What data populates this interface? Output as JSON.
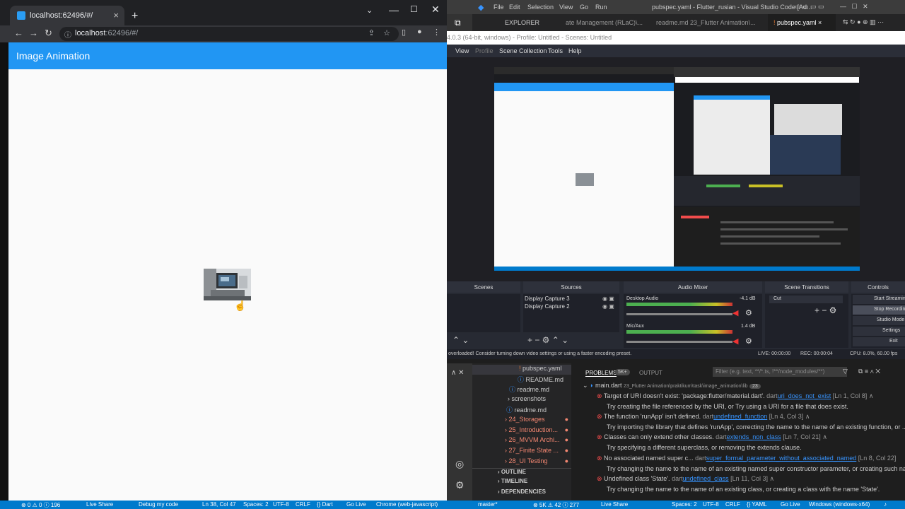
{
  "browser": {
    "tab_title": "localhost:62496/#/",
    "new_tab": "+",
    "url_host": "localhost",
    "url_rest": ":62496/#/"
  },
  "app": {
    "title": "Image Animation"
  },
  "vscode": {
    "menu": [
      "File",
      "Edit",
      "Selection",
      "View",
      "Go",
      "Run"
    ],
    "window_title": "pubspec.yaml - Flutter_rusian - Visual Studio Code [Ad...",
    "sidebar_title": "EXPLORER",
    "tabs": [
      "ate Management (RLaC)\\...",
      "readme.md  23_Flutter Animation\\...",
      "pubspec.yaml"
    ],
    "explorer_items": [
      {
        "label": "pubspec.yaml",
        "icon": "!",
        "color": "#cccccc"
      },
      {
        "label": "README.md",
        "icon": "ⓘ",
        "color": "#cccccc"
      },
      {
        "label": "readme.md",
        "icon": "ⓘ",
        "color": "#cccccc"
      },
      {
        "label": "screenshots",
        "icon": ">",
        "color": "#cccccc"
      },
      {
        "label": "readme.md",
        "icon": "ⓘ",
        "color": "#cccccc"
      },
      {
        "label": "24_Storages",
        "icon": ">",
        "color": "#f48771"
      },
      {
        "label": "25_Introduction...",
        "icon": ">",
        "color": "#f48771"
      },
      {
        "label": "26_MVVM Archi...",
        "icon": ">",
        "color": "#f48771"
      },
      {
        "label": "27_Finite State ...",
        "icon": ">",
        "color": "#f48771"
      },
      {
        "label": "28_UI Testing",
        "icon": ">",
        "color": "#f48771"
      }
    ],
    "outline": [
      "OUTLINE",
      "TIMELINE",
      "DEPENDENCIES"
    ],
    "panel_tabs": {
      "problems": "PROBLEMS",
      "count": "5K+",
      "output": "OUTPUT"
    },
    "filter_placeholder": "Filter (e.g. text, **/*.ts, !**/node_modules/**)",
    "file_header": {
      "name": "main.dart",
      "path": "23_Flutter Animation\\praktikum\\task\\image_animation\\lib",
      "count": "23"
    },
    "problems": [
      {
        "msg": "Target of URI doesn't exist: 'package:flutter/material.dart'.",
        "src": "dart",
        "code": "uri_does_not_exist",
        "loc": "[Ln 1, Col 8]",
        "hint": "Try creating the file referenced by the URI, or Try using a URI for a file that does exist."
      },
      {
        "msg": "The function 'runApp' isn't defined.",
        "src": "dart",
        "code": "undefined_function",
        "loc": "[Ln 4, Col 3]",
        "hint": "Try importing the library that defines 'runApp', correcting the name to the name of an existing function, or ..."
      },
      {
        "msg": "Classes can only extend other classes.",
        "src": "dart",
        "code": "extends_non_class",
        "loc": "[Ln 7, Col 21]",
        "hint": "Try specifying a different superclass, or removing the extends clause."
      },
      {
        "msg": "No associated named super c...",
        "src": "dart",
        "code": "super_formal_parameter_without_associated_named",
        "loc": "[Ln 8, Col 22]",
        "hint": "Try changing the name to the name of an existing named super constructor parameter, or creating such na..."
      },
      {
        "msg": "Undefined class 'State'.",
        "src": "dart",
        "code": "undefined_class",
        "loc": "[Ln 11, Col 3]",
        "hint": "Try changing the name to the name of an existing class, or creating a class with the name 'State'."
      }
    ]
  },
  "obs": {
    "title": "4.0.3 (64-bit, windows) - Profile: Untitled - Scenes: Untitled",
    "menu": [
      "View",
      "Profile",
      "Scene Collection",
      "Tools",
      "Help"
    ],
    "docks": {
      "scenes": "Scenes",
      "sources": "Sources",
      "mixer": "Audio Mixer",
      "transitions": "Scene Transitions",
      "controls": "Controls"
    },
    "sources": [
      "Display Capture 3",
      "Display Capture 2"
    ],
    "mixer": [
      {
        "name": "Desktop Audio",
        "db": "-4.1 dB"
      },
      {
        "name": "Mic/Aux",
        "db": "1.4 dB"
      }
    ],
    "transition": "Cut",
    "controls": [
      "Start Streaming",
      "Stop Recording",
      "Studio Mode",
      "Settings",
      "Exit"
    ],
    "status_msg": "overloaded! Consider turning down video settings or using a faster encoding preset.",
    "live": "LIVE: 00:00:00",
    "rec": "REC: 00:00:04",
    "cpu": "CPU: 8.0%, 60.00 fps"
  },
  "statusbar_left": [
    "⊗ 0 ⚠ 0 ⓘ 196",
    "Live Share",
    "Debug my code",
    "Ln 38, Col 47",
    "Spaces: 2",
    "UTF-8",
    "CRLF",
    "{} Dart",
    "Go Live",
    "Chrome (web-javascript)"
  ],
  "statusbar_right": [
    "master*",
    "⊗ 5K ⚠ 42 ⓘ 277",
    "Live Share",
    "Spaces: 2",
    "UTF-8",
    "CRLF",
    "{} YAML",
    "Go Live",
    "Windows (windows-x64)"
  ]
}
